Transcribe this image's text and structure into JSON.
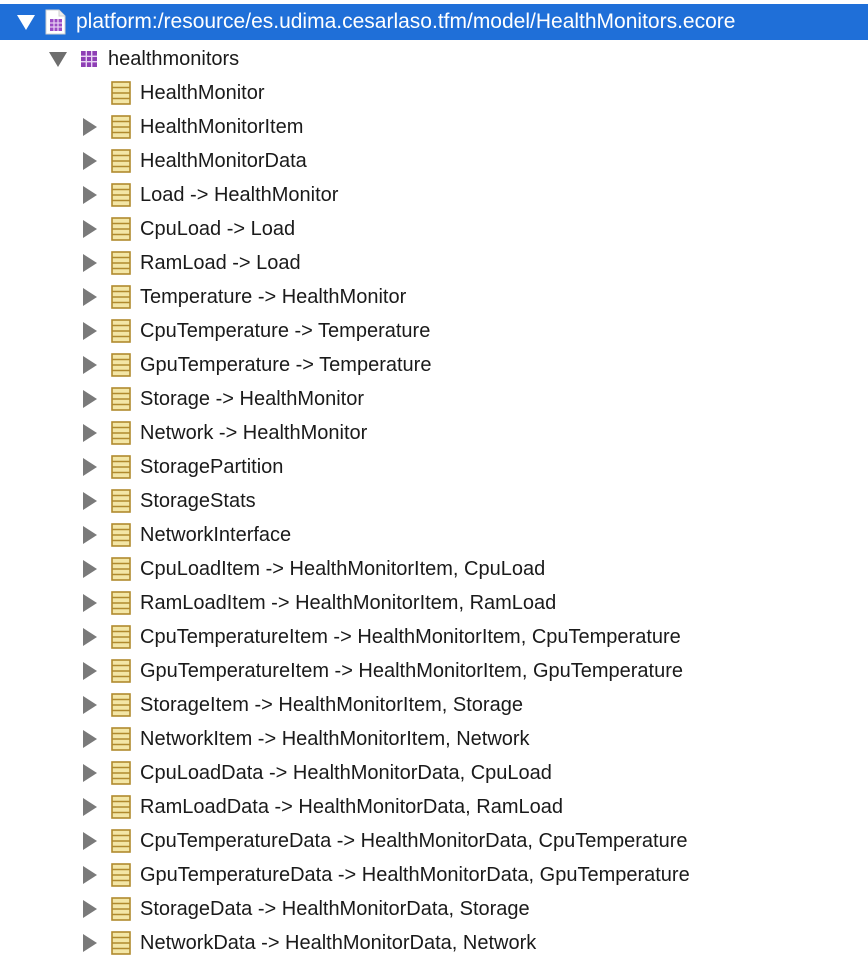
{
  "tree": {
    "root": {
      "label": "platform:/resource/es.udima.cesarlaso.tfm/model/HealthMonitors.ecore",
      "expanded": true,
      "selected": true,
      "icon": "ecore-file-icon"
    },
    "package": {
      "label": "healthmonitors",
      "expanded": true,
      "icon": "epackage-icon"
    },
    "classes": [
      {
        "label": "HealthMonitor",
        "has_children": false,
        "icon": "eclass-icon"
      },
      {
        "label": "HealthMonitorItem",
        "has_children": true,
        "icon": "eclass-icon"
      },
      {
        "label": "HealthMonitorData",
        "has_children": true,
        "icon": "eclass-icon"
      },
      {
        "label": "Load -> HealthMonitor",
        "has_children": true,
        "icon": "eclass-icon"
      },
      {
        "label": "CpuLoad -> Load",
        "has_children": true,
        "icon": "eclass-icon"
      },
      {
        "label": "RamLoad -> Load",
        "has_children": true,
        "icon": "eclass-icon"
      },
      {
        "label": "Temperature -> HealthMonitor",
        "has_children": true,
        "icon": "eclass-icon"
      },
      {
        "label": "CpuTemperature -> Temperature",
        "has_children": true,
        "icon": "eclass-icon"
      },
      {
        "label": "GpuTemperature -> Temperature",
        "has_children": true,
        "icon": "eclass-icon"
      },
      {
        "label": "Storage -> HealthMonitor",
        "has_children": true,
        "icon": "eclass-icon"
      },
      {
        "label": "Network -> HealthMonitor",
        "has_children": true,
        "icon": "eclass-icon"
      },
      {
        "label": "StoragePartition",
        "has_children": true,
        "icon": "eclass-icon"
      },
      {
        "label": "StorageStats",
        "has_children": true,
        "icon": "eclass-icon"
      },
      {
        "label": "NetworkInterface",
        "has_children": true,
        "icon": "eclass-icon"
      },
      {
        "label": "CpuLoadItem -> HealthMonitorItem, CpuLoad",
        "has_children": true,
        "icon": "eclass-icon"
      },
      {
        "label": "RamLoadItem -> HealthMonitorItem, RamLoad",
        "has_children": true,
        "icon": "eclass-icon"
      },
      {
        "label": "CpuTemperatureItem -> HealthMonitorItem, CpuTemperature",
        "has_children": true,
        "icon": "eclass-icon"
      },
      {
        "label": "GpuTemperatureItem -> HealthMonitorItem, GpuTemperature",
        "has_children": true,
        "icon": "eclass-icon"
      },
      {
        "label": "StorageItem -> HealthMonitorItem, Storage",
        "has_children": true,
        "icon": "eclass-icon"
      },
      {
        "label": "NetworkItem -> HealthMonitorItem, Network",
        "has_children": true,
        "icon": "eclass-icon"
      },
      {
        "label": "CpuLoadData -> HealthMonitorData, CpuLoad",
        "has_children": true,
        "icon": "eclass-icon"
      },
      {
        "label": "RamLoadData -> HealthMonitorData, RamLoad",
        "has_children": true,
        "icon": "eclass-icon"
      },
      {
        "label": "CpuTemperatureData -> HealthMonitorData, CpuTemperature",
        "has_children": true,
        "icon": "eclass-icon"
      },
      {
        "label": "GpuTemperatureData -> HealthMonitorData, GpuTemperature",
        "has_children": true,
        "icon": "eclass-icon"
      },
      {
        "label": "StorageData -> HealthMonitorData, Storage",
        "has_children": true,
        "icon": "eclass-icon"
      },
      {
        "label": "NetworkData -> HealthMonitorData, Network",
        "has_children": true,
        "icon": "eclass-icon"
      }
    ]
  },
  "colors": {
    "selection": "#1f6fd8",
    "class_icon_fill": "#f3e6a6",
    "class_icon_stroke": "#b08a2e",
    "package_icon": "#8e3fb5"
  }
}
